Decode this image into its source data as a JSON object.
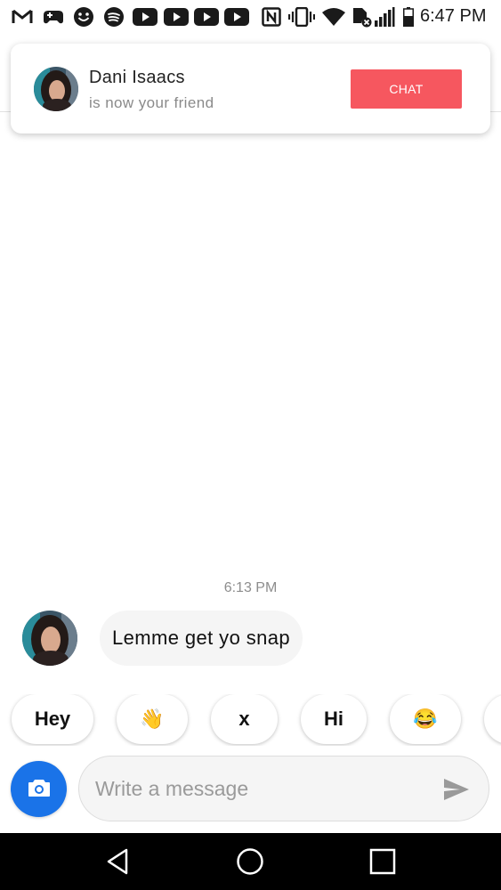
{
  "status_bar": {
    "time": "6:47 PM",
    "icons": [
      "gmail-icon",
      "game-controller-icon",
      "smiley-icon",
      "spotify-icon",
      "youtube-icon",
      "youtube-icon",
      "youtube-icon",
      "youtube-icon",
      "nfc-icon",
      "vibrate-icon",
      "wifi-icon",
      "data-off-icon",
      "signal-icon",
      "battery-icon"
    ]
  },
  "notification": {
    "name": "Dani Isaacs",
    "subtitle": "is now your friend",
    "chat_label": "CHAT",
    "chat_color": "#f6575f"
  },
  "conversation": {
    "timestamp": "6:13 PM",
    "messages": [
      {
        "text": "Lemme get yo snap"
      }
    ]
  },
  "quick_replies": [
    "Hey",
    "👋",
    "x",
    "Hi",
    "😂",
    ""
  ],
  "composer": {
    "placeholder": "Write a message",
    "camera_color": "#1a73e8"
  },
  "nav_bar": {
    "buttons": [
      "back-icon",
      "home-icon",
      "recents-icon"
    ]
  }
}
